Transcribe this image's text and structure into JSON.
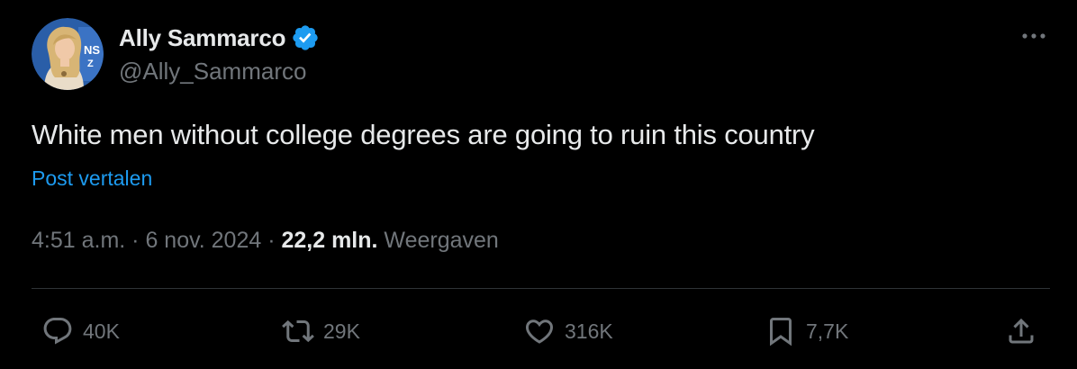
{
  "author": {
    "display_name": "Ally Sammarco",
    "handle": "@Ally_Sammarco",
    "verified": true,
    "avatar_icon": "profile-photo",
    "verified_color": "#1d9bf0"
  },
  "post": {
    "text": "White men without college degrees are going to ruin this country",
    "translate_label": "Post vertalen",
    "timestamp": "4:51 a.m. · 6 nov. 2024 · ",
    "views_count": "22,2 mln.",
    "views_label": "Weergaven"
  },
  "actions": {
    "reply_count": "40K",
    "repost_count": "29K",
    "like_count": "316K",
    "bookmark_count": "7,7K"
  },
  "colors": {
    "background": "#000000",
    "primary_text": "#e7e9ea",
    "secondary_text": "#71767b",
    "accent": "#1d9bf0",
    "divider": "#2f3336"
  }
}
